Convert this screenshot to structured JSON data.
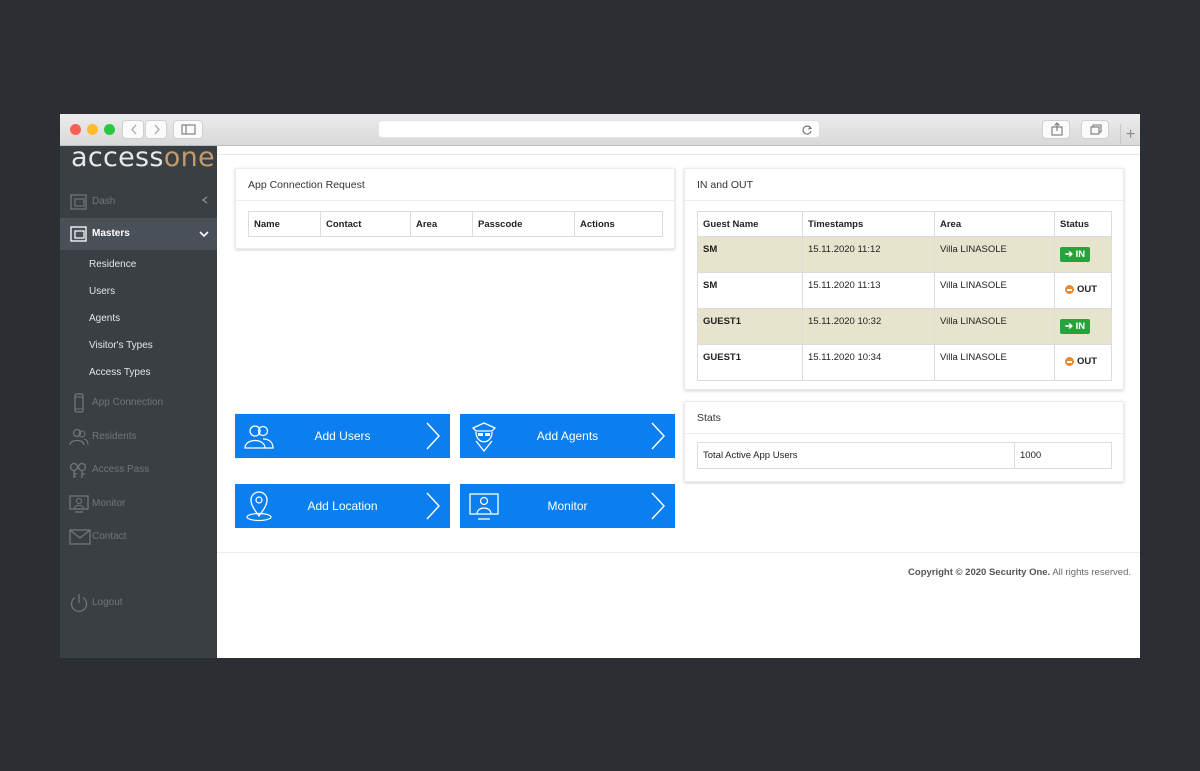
{
  "app": {
    "logo_access": "access",
    "logo_one": "one"
  },
  "sidebar": {
    "items": [
      {
        "label": "Dash"
      },
      {
        "label": "Masters"
      },
      {
        "label": "App Connection"
      },
      {
        "label": "Residents"
      },
      {
        "label": "Access Pass"
      },
      {
        "label": "Monitor"
      },
      {
        "label": "Contact"
      },
      {
        "label": "Logout"
      }
    ],
    "submenu": [
      "Residence",
      "Users",
      "Agents",
      "Visitor's Types",
      "Access Types"
    ]
  },
  "connection_card": {
    "title": "App Connection Request",
    "columns": [
      "Name",
      "Contact",
      "Area",
      "Passcode",
      "Actions"
    ]
  },
  "inout_card": {
    "title": "IN and OUT",
    "columns": [
      "Guest Name",
      "Timestamps",
      "Area",
      "Status"
    ],
    "rows": [
      {
        "name": "SM",
        "time": "15.11.2020 11:12",
        "area": "Villa LINASOLE",
        "status": "IN"
      },
      {
        "name": "SM",
        "time": "15.11.2020 11:13",
        "area": "Villa LINASOLE",
        "status": "OUT"
      },
      {
        "name": "GUEST1",
        "time": "15.11.2020 10:32",
        "area": "Villa LINASOLE",
        "status": "IN"
      },
      {
        "name": "GUEST1",
        "time": "15.11.2020 10:34",
        "area": "Villa LINASOLE",
        "status": "OUT"
      }
    ]
  },
  "stats_card": {
    "title": "Stats",
    "label": "Total Active App Users",
    "value": "1000"
  },
  "actions": {
    "add_users": "Add Users",
    "add_agents": "Add Agents",
    "add_location": "Add Location",
    "monitor": "Monitor"
  },
  "footer": {
    "copyright_bold": "Copyright © 2020 Security One.",
    "copyright_rest": " All rights reserved."
  },
  "colors": {
    "sidebar_bg": "#3a3f44",
    "accent_blue": "#0c7ff0",
    "in_green": "#27a23c",
    "out_orange": "#e8892d",
    "highlight_row": "#e6e4cc",
    "logo_one": "#c09a6c"
  }
}
